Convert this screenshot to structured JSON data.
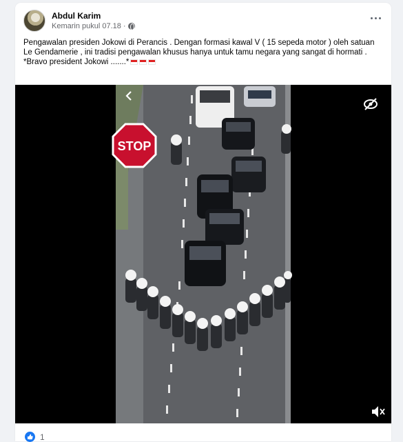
{
  "post": {
    "author": "Abdul Karim",
    "timestamp": "Kemarin pukul 07.18",
    "privacy_icon": "globe-icon",
    "menu_icon": "more-options-icon",
    "text_lines": [
      "Pengawalan presiden  Jokowi di Perancis . Dengan formasi kawal V ( 15 sepeda motor )  oleh satuan Le Gendamerie , ini  tradisi pengawalan khusus hanya untuk tamu negara yang sangat di hormati .",
      "*Bravo president Jokowi .......*"
    ],
    "flags_count": 3
  },
  "video": {
    "sign_text": "STOP",
    "back_icon": "chevron-left-icon",
    "hide_icon": "eye-slash-icon",
    "mute_icon": "speaker-muted-icon"
  },
  "reactions": {
    "icon": "like-icon",
    "count": "1"
  },
  "colors": {
    "accent": "#1877f2",
    "stop_sign": "#c8102e"
  }
}
